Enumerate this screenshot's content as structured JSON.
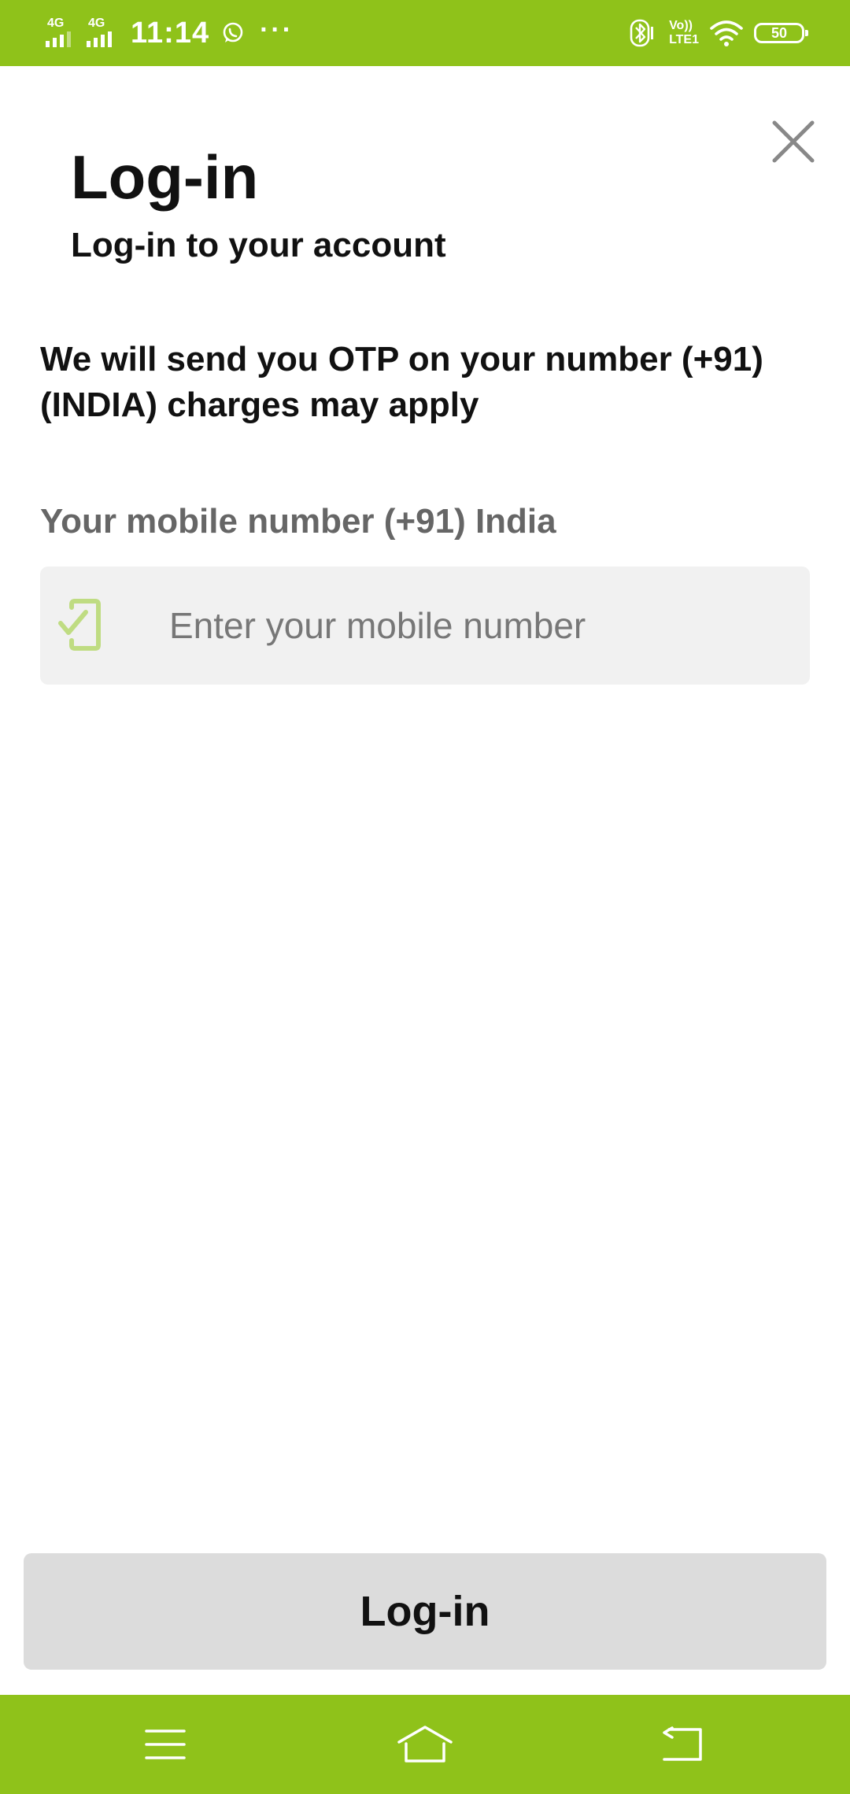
{
  "status_bar": {
    "sim1_network": "4G",
    "sim2_network": "4G",
    "time": "11:14",
    "more_indicator": "···",
    "volte_line1": "Vo))",
    "volte_line2": "LTE1",
    "battery_level": "50",
    "icons": [
      "signal-icon",
      "whatsapp-icon",
      "bluetooth-icon",
      "wifi-icon",
      "battery-icon"
    ]
  },
  "header": {
    "close_icon": "close-icon",
    "title": "Log-in",
    "subtitle": "Log-in to your account"
  },
  "main": {
    "otp_info": "We will send you OTP on your number (+91) (INDIA) charges may apply",
    "mobile_label": "Your mobile number (+91) India",
    "mobile_input": {
      "value": "",
      "placeholder": "Enter your mobile number",
      "icon": "phone-check-icon"
    },
    "login_button": "Log-in"
  },
  "nav_bar": {
    "icons": [
      "menu-icon",
      "home-icon",
      "back-icon"
    ]
  },
  "colors": {
    "brand_green": "#8fc21a",
    "icon_green": "#bfdc82",
    "button_bg": "#dcdcdc",
    "input_bg": "#f1f1f1",
    "label_grey": "#666666"
  }
}
